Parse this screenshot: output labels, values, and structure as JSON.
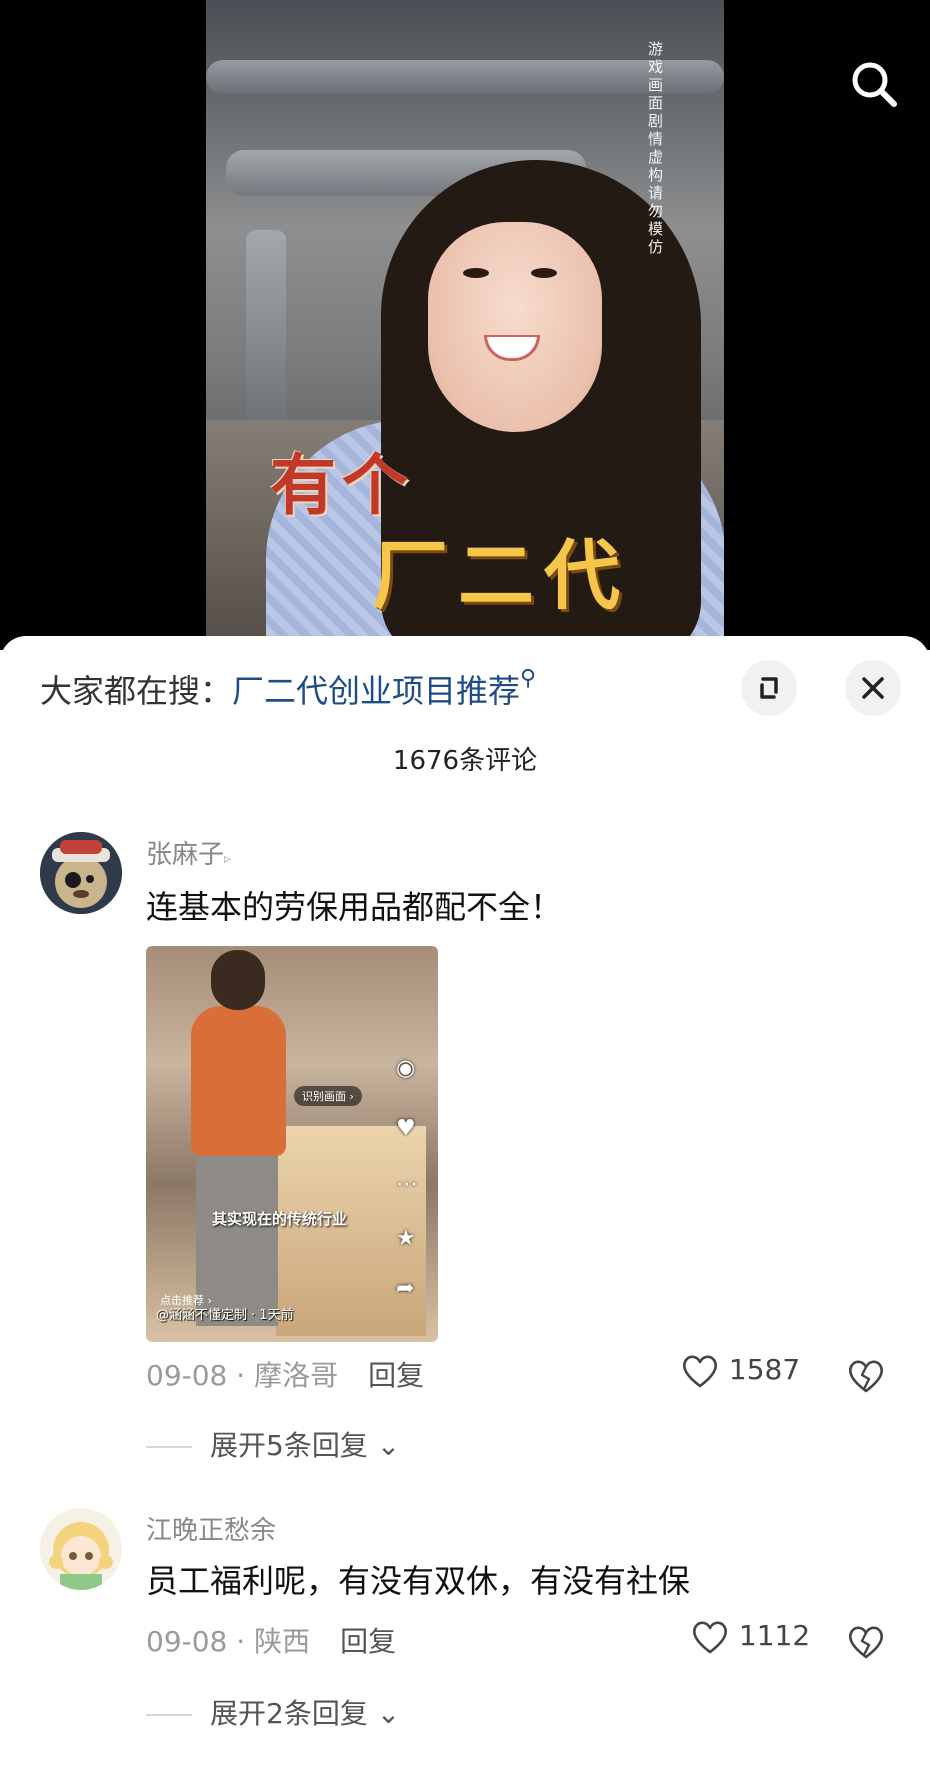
{
  "video": {
    "side_caption": "游戏画面 剧情虚构 请勿模仿",
    "caption_line1": "有个",
    "caption_line2": "厂二代",
    "search_icon": "search-icon"
  },
  "sheet": {
    "hot_search_label": "大家都在搜：",
    "hot_search_keyword": "厂二代创业项目推荐",
    "comment_count": "1676条评论",
    "expand_icon": "expand-icon",
    "close_icon": "close-icon"
  },
  "comments": [
    {
      "username": "张麻子",
      "text": "连基本的劳保用品都配不全！",
      "date": "09-08",
      "location": "摩洛哥",
      "reply_label": "回复",
      "likes": "1587",
      "more_replies": "展开5条回复",
      "thumbnail": {
        "subtitle": "其实现在的传统行业",
        "tag": "识别画面 ›",
        "author": "@涵涵不懂定制 · 1天前",
        "recommend": "点击推荐 ›"
      }
    },
    {
      "username": "江晚正愁余",
      "text": "员工福利呢，有没有双休，有没有社保",
      "date": "09-08",
      "location": "陕西",
      "reply_label": "回复",
      "likes": "1112",
      "more_replies": "展开2条回复"
    }
  ]
}
